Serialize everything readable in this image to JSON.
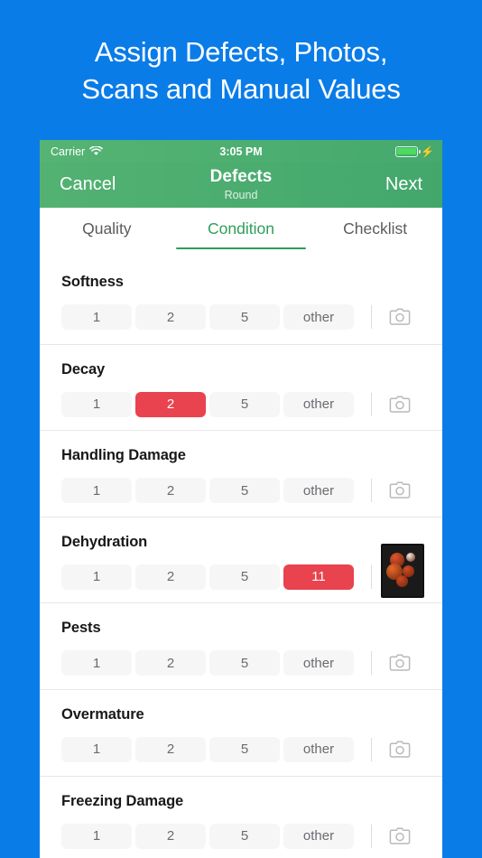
{
  "promo": {
    "headline": "Assign Defects, Photos,\nScans and Manual Values",
    "background_color": "#0A7CE8"
  },
  "status_bar": {
    "carrier": "Carrier",
    "wifi_icon": "wifi-icon",
    "time": "3:05 PM",
    "battery_icon": "battery-icon",
    "charging_icon": "lightning-bolt-icon"
  },
  "nav_bar": {
    "cancel_label": "Cancel",
    "title": "Defects",
    "subtitle": "Round",
    "next_label": "Next",
    "accent_color": "#4aab6f"
  },
  "tabs": [
    {
      "label": "Quality",
      "active": false
    },
    {
      "label": "Condition",
      "active": true
    },
    {
      "label": "Checklist",
      "active": false
    }
  ],
  "colors": {
    "tab_active": "#2e9e5b",
    "selected_pill": "#e8434e",
    "pill_background": "#f6f6f7"
  },
  "defects": [
    {
      "name": "Softness",
      "options": [
        "1",
        "2",
        "5",
        "other"
      ],
      "selected_index": -1,
      "media": "camera-icon"
    },
    {
      "name": "Decay",
      "options": [
        "1",
        "2",
        "5",
        "other"
      ],
      "selected_index": 1,
      "media": "camera-icon"
    },
    {
      "name": "Handling Damage",
      "options": [
        "1",
        "2",
        "5",
        "other"
      ],
      "selected_index": -1,
      "media": "camera-icon"
    },
    {
      "name": "Dehydration",
      "options": [
        "1",
        "2",
        "5",
        "11"
      ],
      "selected_index": 3,
      "media": "photo-thumbnail"
    },
    {
      "name": "Pests",
      "options": [
        "1",
        "2",
        "5",
        "other"
      ],
      "selected_index": -1,
      "media": "camera-icon"
    },
    {
      "name": "Overmature",
      "options": [
        "1",
        "2",
        "5",
        "other"
      ],
      "selected_index": -1,
      "media": "camera-icon"
    },
    {
      "name": "Freezing Damage",
      "options": [
        "1",
        "2",
        "5",
        "other"
      ],
      "selected_index": -1,
      "media": "camera-icon"
    }
  ]
}
